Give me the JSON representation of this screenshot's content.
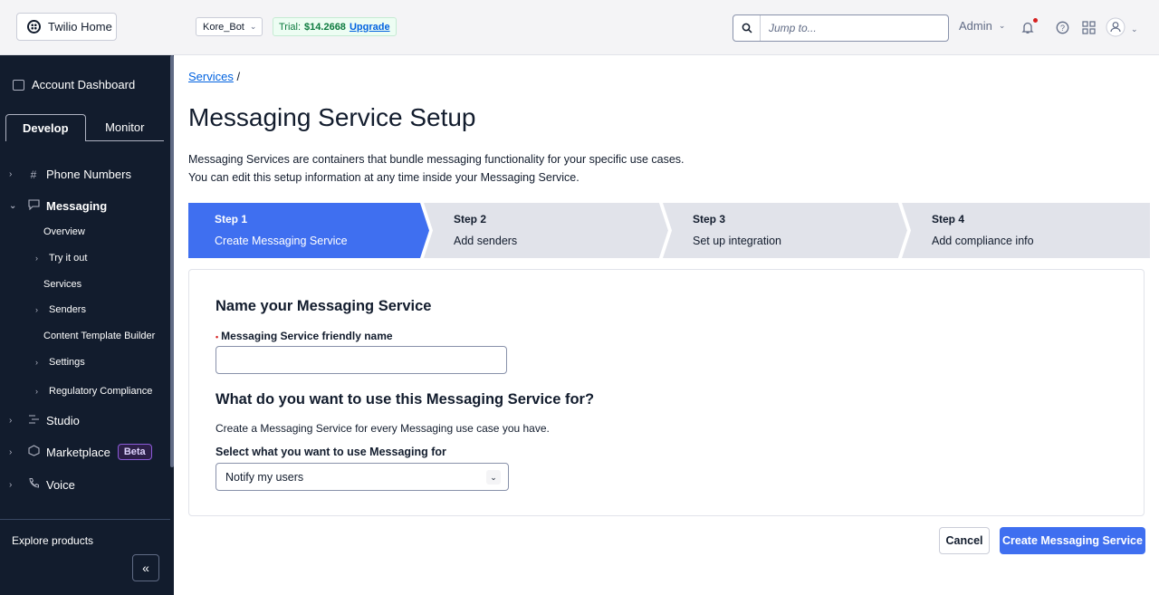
{
  "topbar": {
    "home_label": "Twilio Home",
    "account_name": "Kore_Bot",
    "trial_label": "Trial:",
    "trial_amount": "$14.2668",
    "upgrade_label": "Upgrade",
    "search_placeholder": "Jump to...",
    "admin_label": "Admin"
  },
  "sidebar": {
    "account_dashboard": "Account Dashboard",
    "tabs": [
      {
        "label": "Develop",
        "active": true
      },
      {
        "label": "Monitor",
        "active": false
      }
    ],
    "items": [
      {
        "label": "Phone Numbers",
        "icon": "hash-icon"
      },
      {
        "label": "Messaging",
        "icon": "chat-icon",
        "expanded": true
      },
      {
        "label": "Studio",
        "icon": "studio-icon"
      },
      {
        "label": "Marketplace",
        "icon": "marketplace-icon",
        "badge": "Beta"
      },
      {
        "label": "Voice",
        "icon": "phone-icon"
      }
    ],
    "messaging_children": [
      {
        "label": "Overview"
      },
      {
        "label": "Try it out"
      },
      {
        "label": "Services"
      },
      {
        "label": "Senders"
      },
      {
        "label": "Content Template Builder"
      },
      {
        "label": "Settings"
      },
      {
        "label": "Regulatory Compliance"
      }
    ],
    "explore_label": "Explore products",
    "collapse_label": "«"
  },
  "main": {
    "breadcrumb_link": "Services",
    "breadcrumb_sep": "/",
    "title": "Messaging Service Setup",
    "description_line1": "Messaging Services are containers that bundle messaging functionality for your specific use cases.",
    "description_line2": "You can edit this setup information at any time inside your Messaging Service.",
    "steps": [
      {
        "num": "Step 1",
        "label": "Create Messaging Service",
        "active": true
      },
      {
        "num": "Step 2",
        "label": "Add senders",
        "active": false
      },
      {
        "num": "Step 3",
        "label": "Set up integration",
        "active": false
      },
      {
        "num": "Step 4",
        "label": "Add compliance info",
        "active": false
      }
    ],
    "card": {
      "name_heading": "Name your Messaging Service",
      "name_field_label": "Messaging Service friendly name",
      "name_field_required": "•",
      "name_field_value": "",
      "use_heading": "What do you want to use this Messaging Service for?",
      "use_help": "Create a Messaging Service for every Messaging use case you have.",
      "select_label": "Select what you want to use Messaging for",
      "select_value": "Notify my users"
    },
    "cancel_label": "Cancel",
    "create_label": "Create Messaging Service"
  },
  "colors": {
    "primary": "#3f6ff0",
    "sidebar_bg": "#121c2d",
    "step_inactive": "#e1e3ea"
  }
}
